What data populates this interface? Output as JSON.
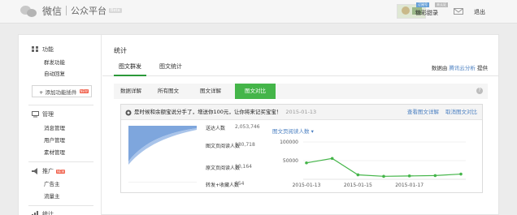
{
  "topbar": {
    "app_name": "微信",
    "platform": "公众平台",
    "beta": "Beta",
    "badge_verified": "订阅号",
    "badge_unverified": "未认证",
    "account_name": "糖彩甜录",
    "logout": "退出"
  },
  "sidebar": {
    "features": {
      "title": "功能",
      "items": [
        "群发功能",
        "自动回复"
      ],
      "add_plugin": "+ 添加功能插件",
      "new_tag": "NEW"
    },
    "manage": {
      "title": "管理",
      "items": [
        "消息管理",
        "用户管理",
        "素材管理"
      ]
    },
    "promote": {
      "title": "推广",
      "new_tag": "NEW",
      "items": [
        "广告主",
        "流量主"
      ]
    },
    "stats_title": "统计"
  },
  "main": {
    "page_title": "统计",
    "tabs": [
      "图文群发",
      "图文统计"
    ],
    "data_source": {
      "prefix": "数据由",
      "link": "腾讯云分析",
      "suffix": "提供"
    },
    "subtabs": [
      "数据详解",
      "所有图文",
      "图文详解",
      "图文对比"
    ],
    "help": "?"
  },
  "card": {
    "headline": "是时候和余额宝说分手了，增送你100元，让你将来记买宝宝！",
    "date": "2015-01-13",
    "links": {
      "view": "查看图文详解",
      "cancel": "取消图文对比"
    },
    "funnel_rows": [
      {
        "label": "送达人数",
        "value": "2,053,746"
      },
      {
        "label": "图文页阅读人数",
        "value": "130,718"
      },
      {
        "label": "原文页阅读人数",
        "value": "10,164"
      },
      {
        "label": "转发+收藏人数",
        "value": "954"
      }
    ],
    "chart_title": "图文页阅读人数 ▾"
  },
  "colors": {
    "accent_green": "#44b549",
    "link_blue": "#4a7fc1"
  },
  "chart_data": {
    "type": "line",
    "title": "图文页阅读人数",
    "x": [
      "2015-01-13",
      "2015-01-14",
      "2015-01-15",
      "2015-01-16",
      "2015-01-17",
      "2015-01-18",
      "2015-01-19"
    ],
    "x_tick_labels": [
      "2015-01-13",
      "2015-01-15",
      "2015-01-17"
    ],
    "series": [
      {
        "values": [
          44000,
          56000,
          12000,
          8000,
          9000,
          10000,
          14000
        ]
      }
    ],
    "yticks": [
      "50000",
      "100000"
    ],
    "ylim": [
      0,
      100000
    ],
    "grid": true
  }
}
